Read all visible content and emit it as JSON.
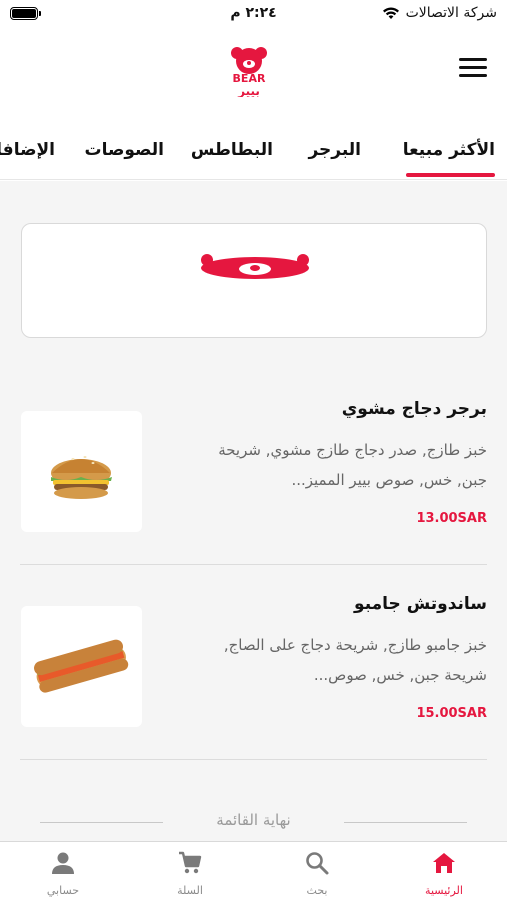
{
  "status_bar": {
    "time": "٢:٢٤ م",
    "carrier": "شركة الاتصالات"
  },
  "header": {
    "logo_text_en": "BEAR",
    "logo_text_ar": "بيير",
    "menu_icon": "hamburger-icon"
  },
  "tabs": [
    {
      "label": "الأكثر مبيعا",
      "active": true
    },
    {
      "label": "البرجر",
      "active": false
    },
    {
      "label": "البطاطس",
      "active": false
    },
    {
      "label": "الصوصات",
      "active": false
    },
    {
      "label": "الإضافات",
      "active": false
    }
  ],
  "products": [
    {
      "name": "برجر دجاج مشوي",
      "description": "خبز طازج, صدر دجاج طازج مشوي, شريحة جبن, خس, صوص بيير المميز...",
      "price": "13.00SAR"
    },
    {
      "name": "ساندوتش جامبو",
      "description": "خبز جامبو طازج, شريحة دجاج على الصاج, شريحة جبن, خس, صوص...",
      "price": "15.00SAR"
    }
  ],
  "end_of_list": "نهاية القائمة",
  "bottom_nav": [
    {
      "label": "الرئيسية",
      "icon": "home-icon",
      "active": true
    },
    {
      "label": "بحث",
      "icon": "search-icon",
      "active": false
    },
    {
      "label": "السلة",
      "icon": "cart-icon",
      "active": false
    },
    {
      "label": "حسابي",
      "icon": "user-icon",
      "active": false
    }
  ],
  "colors": {
    "accent": "#e5173f",
    "background": "#f5f5f5",
    "muted_text": "#666666"
  }
}
